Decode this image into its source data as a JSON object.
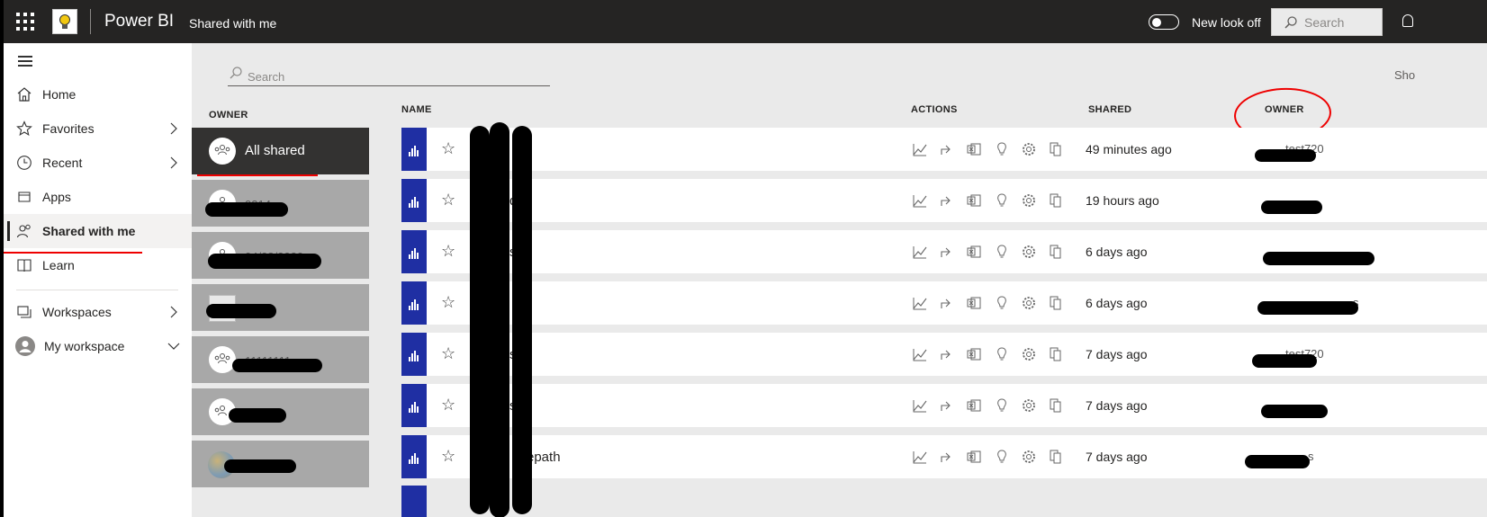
{
  "topbar": {
    "product": "Power BI",
    "page_title": "Shared with me",
    "toggle_label": "New look off",
    "search_placeholder": "Search"
  },
  "nav": {
    "items": [
      {
        "label": "Home",
        "icon": "home-icon"
      },
      {
        "label": "Favorites",
        "icon": "star-icon"
      },
      {
        "label": "Recent",
        "icon": "clock-icon"
      },
      {
        "label": "Apps",
        "icon": "apps-icon"
      },
      {
        "label": "Shared with me",
        "icon": "shared-people-icon"
      },
      {
        "label": "Learn",
        "icon": "book-icon"
      },
      {
        "label": "Workspaces",
        "icon": "workspaces-icon"
      },
      {
        "label": "My workspace",
        "icon": "avatar-icon"
      }
    ]
  },
  "main": {
    "search_placeholder": "Search",
    "cut_text": "Sho",
    "owner_header": "OWNER",
    "columns": {
      "name": "NAME",
      "actions": "ACTIONS",
      "shared": "SHARED",
      "owner": "OWNER"
    },
    "owners": [
      {
        "label": "All shared",
        "ghost": ""
      },
      {
        "label": "",
        "ghost": "0214"
      },
      {
        "label": "",
        "ghost": "04/08/2020"
      },
      {
        "label": "",
        "ghost": ""
      },
      {
        "label": "",
        "ghost": "11111111"
      },
      {
        "label": "",
        "ghost": ""
      },
      {
        "label": "",
        "ghost": ""
      }
    ],
    "rows": [
      {
        "name": "",
        "shared": "49 minutes ago",
        "owner": "test720"
      },
      {
        "name": "d",
        "shared": "19 hours ago",
        "owner": ""
      },
      {
        "name": "s",
        "shared": "6 days ago",
        "owner": ""
      },
      {
        "name": "",
        "shared": "6 days ago",
        "owner": "s"
      },
      {
        "name": "s",
        "shared": "7 days ago",
        "owner": "test720"
      },
      {
        "name": "s",
        "shared": "7 days ago",
        "owner": ""
      },
      {
        "name": "repath",
        "shared": "7 days ago",
        "owner": "s"
      }
    ]
  },
  "colors": {
    "topbar": "#252423",
    "tile": "#1f2fa3",
    "annotation": "#e00000"
  }
}
